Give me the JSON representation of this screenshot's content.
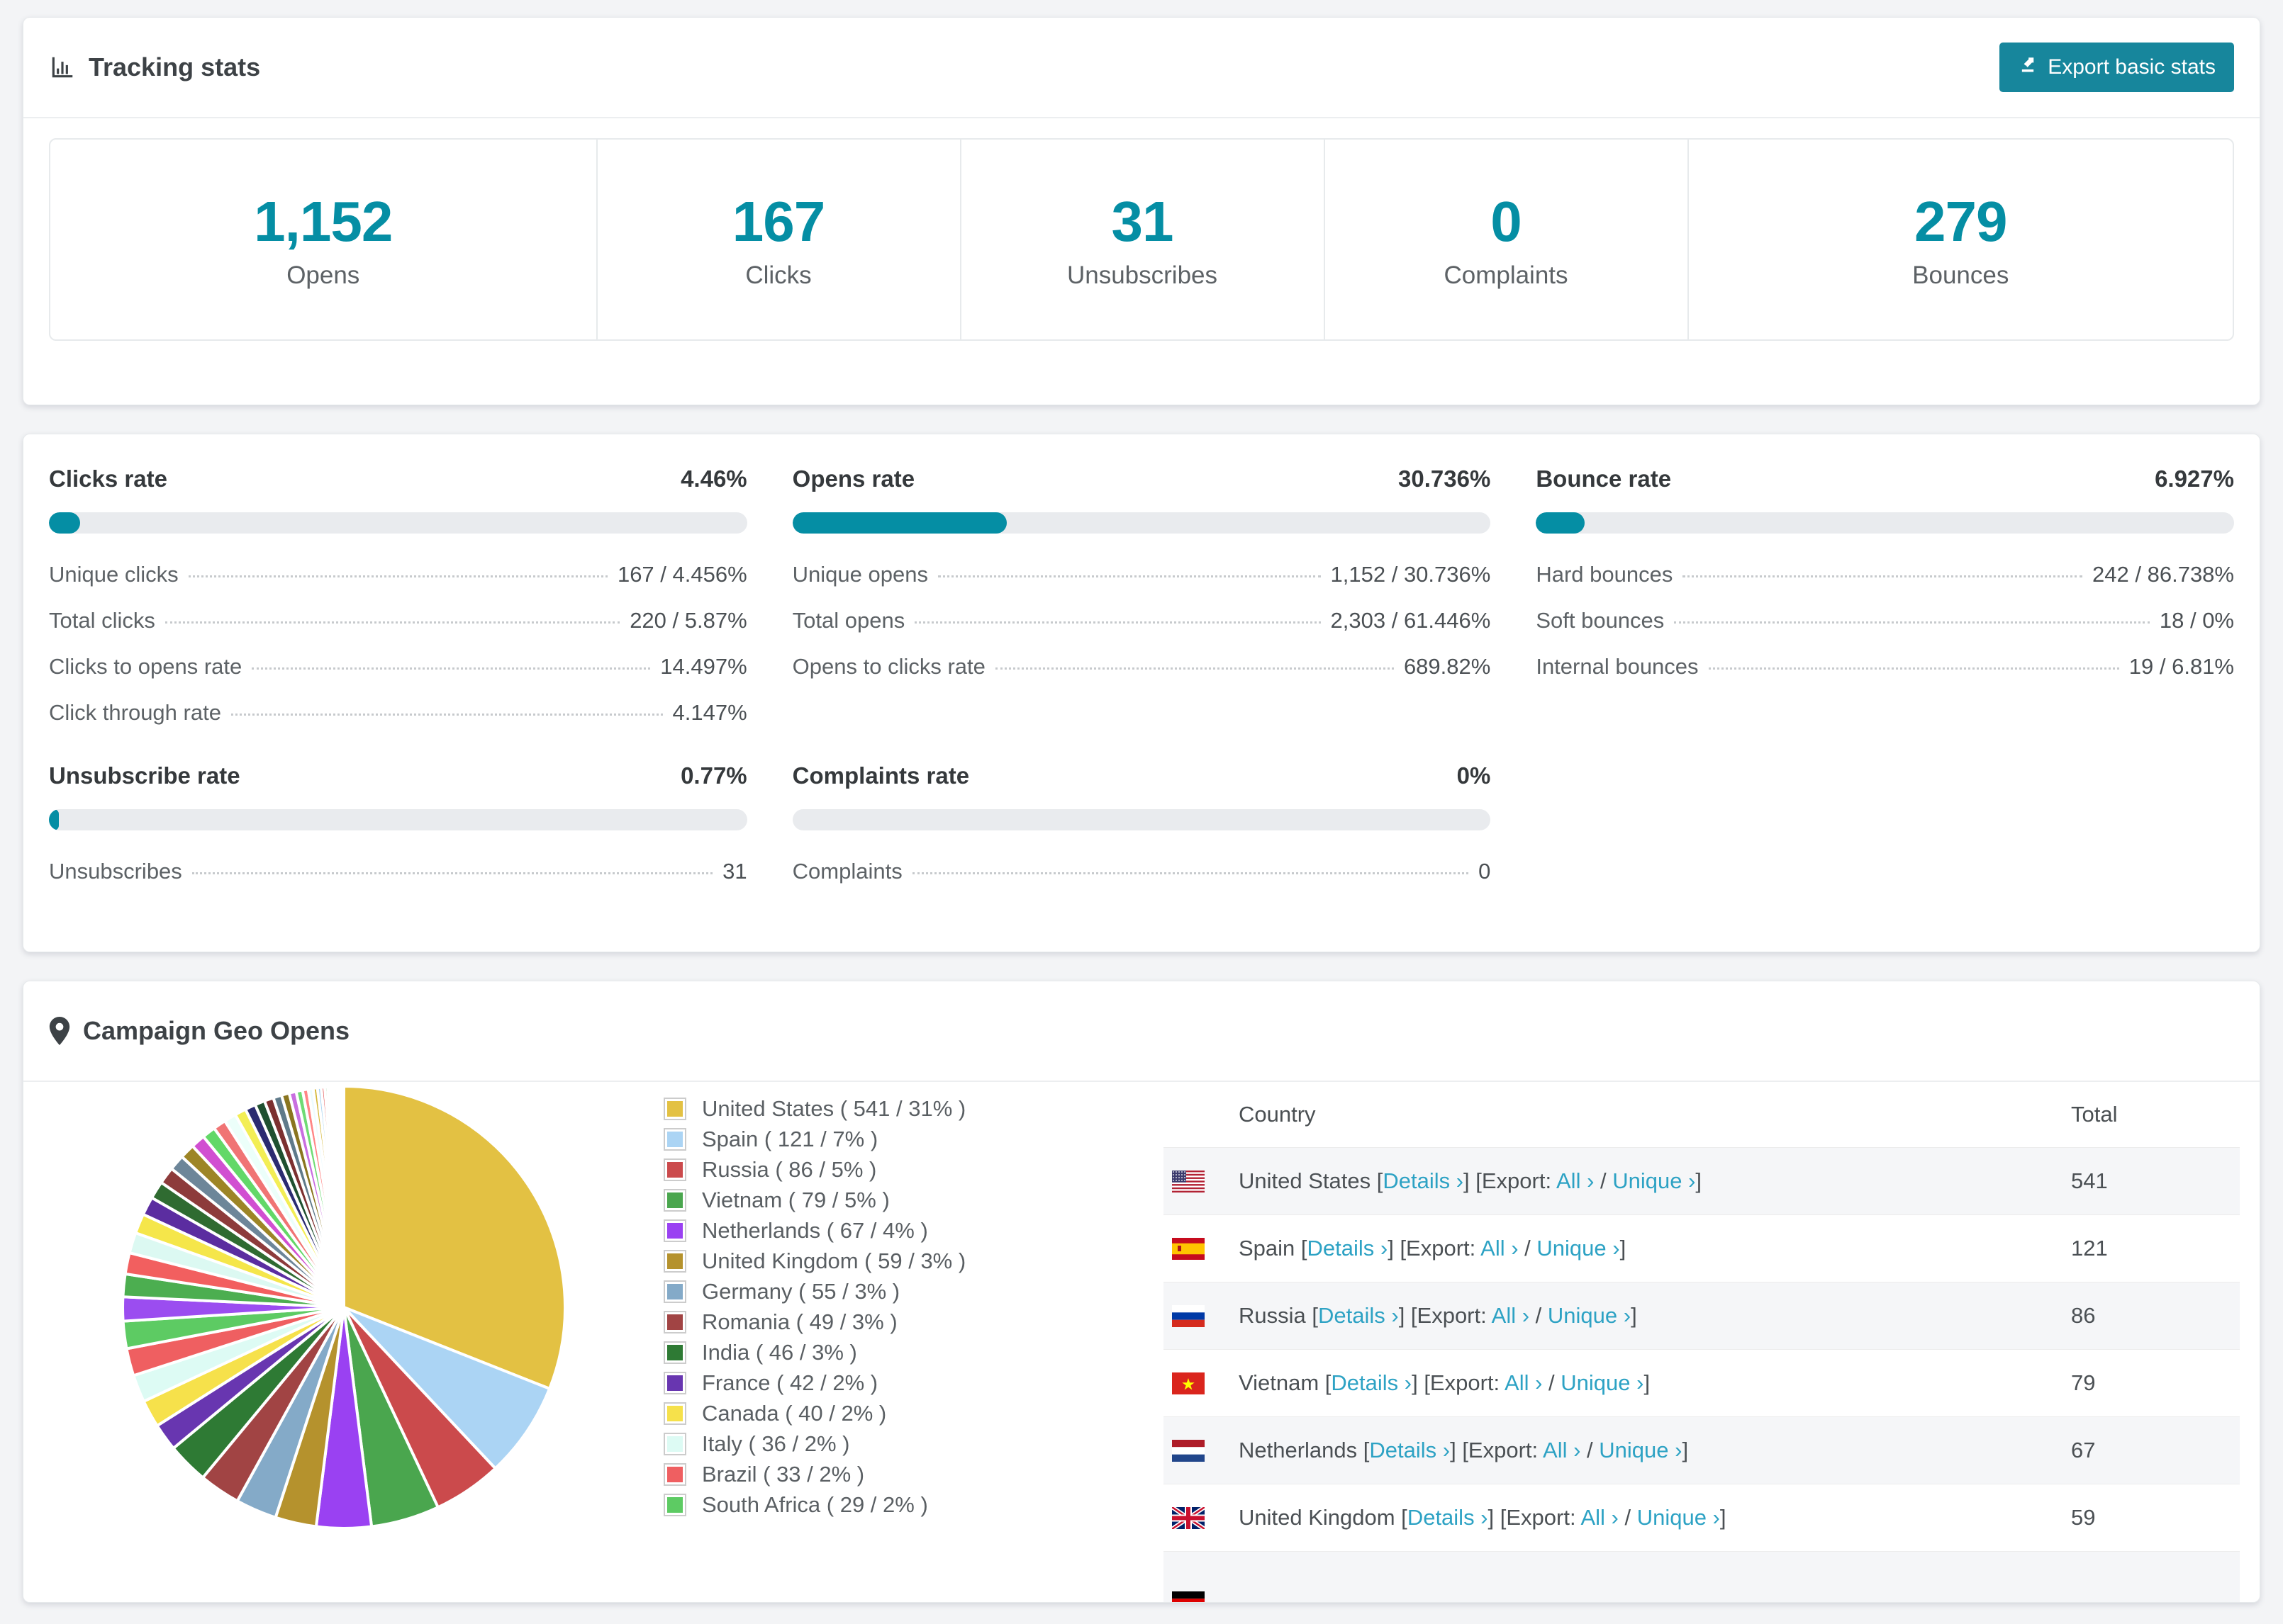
{
  "theme": {
    "accent": "#058ea4",
    "link_color": "#2da2c4",
    "page_bg": "#f3f4f6",
    "bar_track": "#e9ebee",
    "row_stripe": "#f5f6f8",
    "button_bg": "#17869c"
  },
  "tracking": {
    "title": "Tracking stats",
    "export_button": "Export basic stats",
    "stats": [
      {
        "value": "1,152",
        "label": "Opens"
      },
      {
        "value": "167",
        "label": "Clicks"
      },
      {
        "value": "31",
        "label": "Unsubscribes"
      },
      {
        "value": "0",
        "label": "Complaints"
      },
      {
        "value": "279",
        "label": "Bounces"
      }
    ]
  },
  "rates": {
    "panels": [
      {
        "title": "Clicks rate",
        "pct": "4.46%",
        "bar_pct": 4.46,
        "rows": [
          [
            "Unique clicks",
            "167 / 4.456%"
          ],
          [
            "Total clicks",
            "220 / 5.87%"
          ],
          [
            "Clicks to opens rate",
            "14.497%"
          ],
          [
            "Click through rate",
            "4.147%"
          ]
        ]
      },
      {
        "title": "Opens rate",
        "pct": "30.736%",
        "bar_pct": 30.736,
        "rows": [
          [
            "Unique opens",
            "1,152 / 30.736%"
          ],
          [
            "Total opens",
            "2,303 / 61.446%"
          ],
          [
            "Opens to clicks rate",
            "689.82%"
          ]
        ]
      },
      {
        "title": "Bounce rate",
        "pct": "6.927%",
        "bar_pct": 6.927,
        "rows": [
          [
            "Hard bounces",
            "242 / 86.738%"
          ],
          [
            "Soft bounces",
            "18 / 0%"
          ],
          [
            "Internal bounces",
            "19 / 6.81%"
          ]
        ]
      },
      {
        "title": "Unsubscribe rate",
        "pct": "0.77%",
        "bar_pct": 0.77,
        "rows": [
          [
            "Unsubscribes",
            "31"
          ]
        ]
      },
      {
        "title": "Complaints rate",
        "pct": "0%",
        "bar_pct": 0,
        "rows": [
          [
            "Complaints",
            "0"
          ]
        ]
      }
    ]
  },
  "geo": {
    "title": "Campaign Geo Opens",
    "table": {
      "columns": [
        "Country",
        "Total"
      ],
      "link_labels": {
        "details": "Details",
        "export_label": "Export:",
        "all": "All",
        "unique": "Unique",
        "chevron": "›"
      },
      "rows": [
        {
          "country": "United States",
          "flag": "us",
          "total": "541"
        },
        {
          "country": "Spain",
          "flag": "es",
          "total": "121"
        },
        {
          "country": "Russia",
          "flag": "ru",
          "total": "86"
        },
        {
          "country": "Vietnam",
          "flag": "vn",
          "total": "79"
        },
        {
          "country": "Netherlands",
          "flag": "nl",
          "total": "67"
        },
        {
          "country": "United Kingdom",
          "flag": "gb",
          "total": "59"
        },
        {
          "country": "",
          "flag": "de",
          "total": "",
          "partial": true
        }
      ]
    }
  },
  "chart_data": {
    "type": "pie",
    "title": "Campaign Geo Opens",
    "legend_position": "right",
    "start_angle": 0,
    "entries": [
      {
        "label": "United States",
        "value": 541,
        "pct": 31,
        "color": "#e3c143"
      },
      {
        "label": "Spain",
        "value": 121,
        "pct": 7,
        "color": "#abd4f4"
      },
      {
        "label": "Russia",
        "value": 86,
        "pct": 5,
        "color": "#cb4a4c"
      },
      {
        "label": "Vietnam",
        "value": 79,
        "pct": 5,
        "color": "#4aa64e"
      },
      {
        "label": "Netherlands",
        "value": 67,
        "pct": 4,
        "color": "#9a41f2"
      },
      {
        "label": "United Kingdom",
        "value": 59,
        "pct": 3,
        "color": "#b5922d"
      },
      {
        "label": "Germany",
        "value": 55,
        "pct": 3,
        "color": "#84aac8"
      },
      {
        "label": "Romania",
        "value": 49,
        "pct": 3,
        "color": "#a14444"
      },
      {
        "label": "India",
        "value": 46,
        "pct": 3,
        "color": "#2e7a34"
      },
      {
        "label": "France",
        "value": 42,
        "pct": 2,
        "color": "#6836b0"
      },
      {
        "label": "Canada",
        "value": 40,
        "pct": 2,
        "color": "#f6e14b"
      },
      {
        "label": "Italy",
        "value": 36,
        "pct": 2,
        "color": "#ddfbf4"
      },
      {
        "label": "Brazil",
        "value": 33,
        "pct": 2,
        "color": "#ef5f61"
      },
      {
        "label": "South Africa",
        "value": 29,
        "pct": 2,
        "color": "#5dcb63"
      }
    ],
    "unlabeled_tail": {
      "note": "long tail of small unlabeled country slices, estimated",
      "total_pct": 26,
      "pcts": [
        1.7,
        1.6,
        1.5,
        1.45,
        1.4,
        1.3,
        1.25,
        1.2,
        1.1,
        1.05,
        1.0,
        0.95,
        0.9,
        0.85,
        0.8,
        0.75,
        0.7,
        0.65,
        0.6,
        0.55,
        0.5,
        0.45,
        0.4,
        0.35,
        0.3,
        0.27,
        0.24,
        0.21,
        0.18,
        0.16,
        0.14,
        0.12,
        0.1,
        0.09,
        0.08,
        0.07,
        0.06,
        0.05,
        0.04,
        0.04
      ],
      "colors": [
        "#9b4df0",
        "#4cae50",
        "#f25f5f",
        "#dcf9f2",
        "#f5e64a",
        "#5b2da0",
        "#2f6b31",
        "#8d3b3b",
        "#6d8699",
        "#9d8526",
        "#d14fd1",
        "#63d868",
        "#f07474",
        "#ecfffa",
        "#f3ee55",
        "#2b2b70",
        "#1f5030",
        "#7c3030",
        "#5f7a8a",
        "#8a7520",
        "#c86ee0",
        "#6fdb74",
        "#ff8585",
        "#eefcff",
        "#d4b83a",
        "#a8d3f0",
        "#e05555",
        "#57b85c",
        "#8f5ae8",
        "#e0c8f0",
        "#fa6e6e",
        "#bfeffa",
        "#ffe680",
        "#7744bb",
        "#44aa77",
        "#cc5555",
        "#88aacc",
        "#ccaa33",
        "#ee77ee",
        "#99ee99"
      ]
    }
  }
}
